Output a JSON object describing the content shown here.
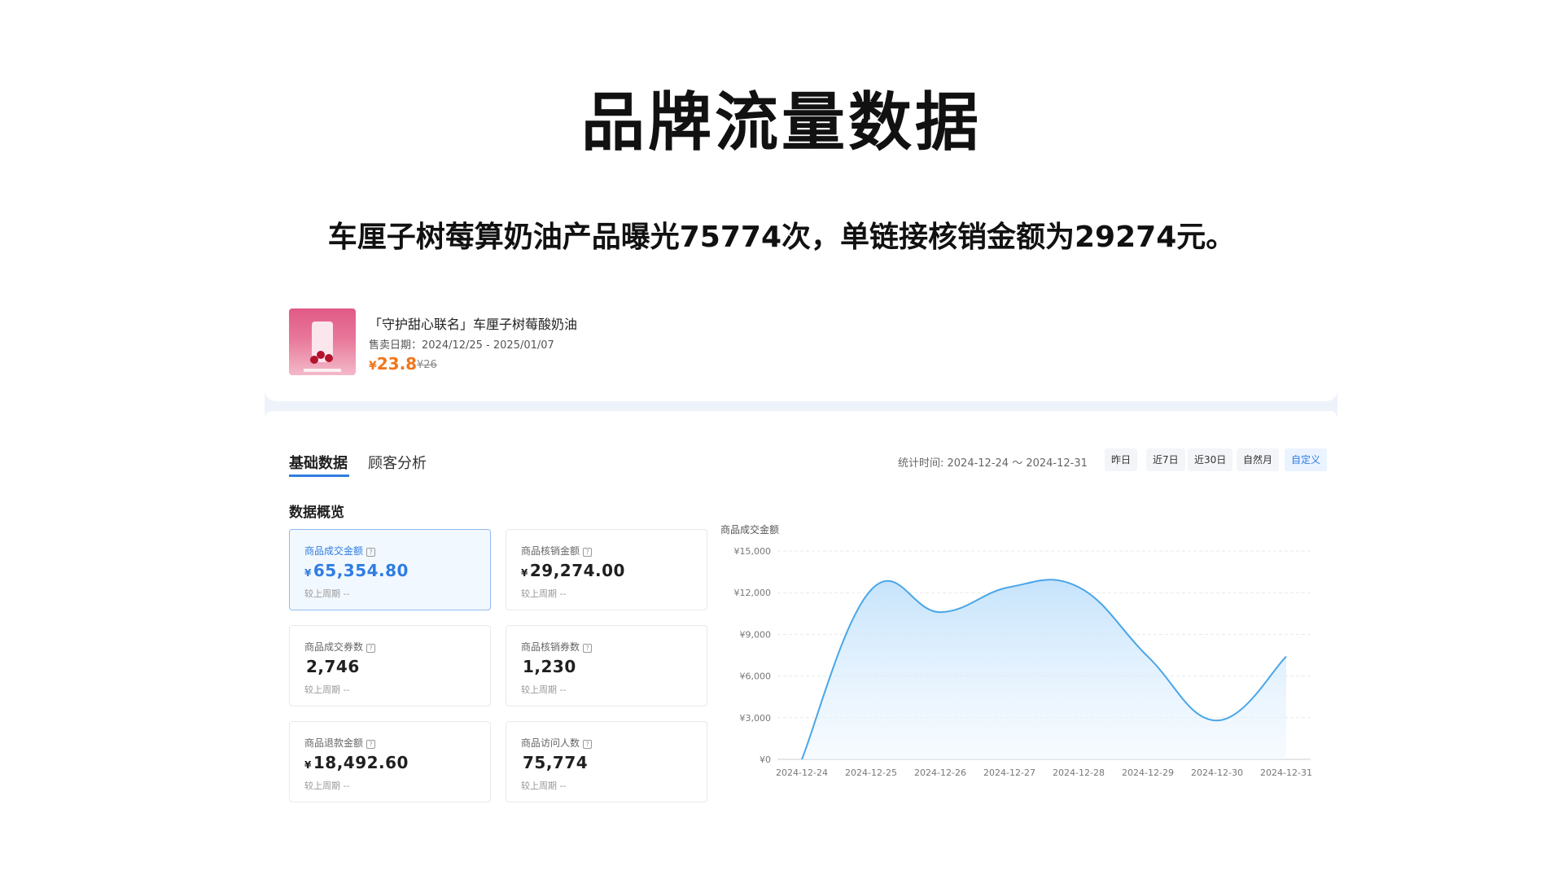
{
  "slide": {
    "title": "品牌流量数据",
    "subtitle": "车厘子树莓算奶油产品曝光75774次，单链接核销金额为29274元。"
  },
  "product": {
    "name": "「守护甜心联名」车厘子树莓酸奶油",
    "dates": "售卖日期：2024/12/25 - 2025/01/07",
    "currency": "¥",
    "price": "23.8",
    "orig_price": "¥26"
  },
  "tabs": [
    {
      "label": "基础数据",
      "active": true
    },
    {
      "label": "顾客分析",
      "active": false
    }
  ],
  "stat_time": "统计时间: 2024-12-24 ～ 2024-12-31",
  "ranges": [
    {
      "label": "昨日"
    },
    {
      "label": "近7日"
    },
    {
      "label": "近30日"
    },
    {
      "label": "自然月"
    },
    {
      "label": "自定义",
      "active": true
    }
  ],
  "section_title": "数据概览",
  "help_glyph": "?",
  "kpis": [
    {
      "label": "商品成交金额",
      "currency": "¥",
      "value": "65,354.80",
      "compare": "较上周期 --",
      "active": true
    },
    {
      "label": "商品核销金额",
      "currency": "¥",
      "value": "29,274.00",
      "compare": "较上周期 --"
    },
    {
      "label": "商品成交券数",
      "currency": "",
      "value": "2,746",
      "compare": "较上周期 --"
    },
    {
      "label": "商品核销券数",
      "currency": "",
      "value": "1,230",
      "compare": "较上周期 --"
    },
    {
      "label": "商品退款金额",
      "currency": "¥",
      "value": "18,492.60",
      "compare": "较上周期 --"
    },
    {
      "label": "商品访问人数",
      "currency": "",
      "value": "75,774",
      "compare": "较上周期 --"
    }
  ],
  "colors": {
    "accent": "#2f7de1",
    "price": "#f0761c",
    "line": "#4aa6e8"
  },
  "chart_data": {
    "type": "area",
    "title": "商品成交金额",
    "x": [
      "2024-12-24",
      "2024-12-25",
      "2024-12-26",
      "2024-12-27",
      "2024-12-28",
      "2024-12-29",
      "2024-12-30",
      "2024-12-31"
    ],
    "series": [
      {
        "values": [
          0,
          12200,
          10600,
          12400,
          12400,
          7400,
          2800,
          7400
        ]
      }
    ],
    "ylim": [
      0,
      15000
    ],
    "yticks": [
      0,
      3000,
      6000,
      9000,
      12000,
      15000
    ],
    "ytick_labels": [
      "¥0",
      "¥3,000",
      "¥6,000",
      "¥9,000",
      "¥12,000",
      "¥15,000"
    ],
    "grid": true
  }
}
